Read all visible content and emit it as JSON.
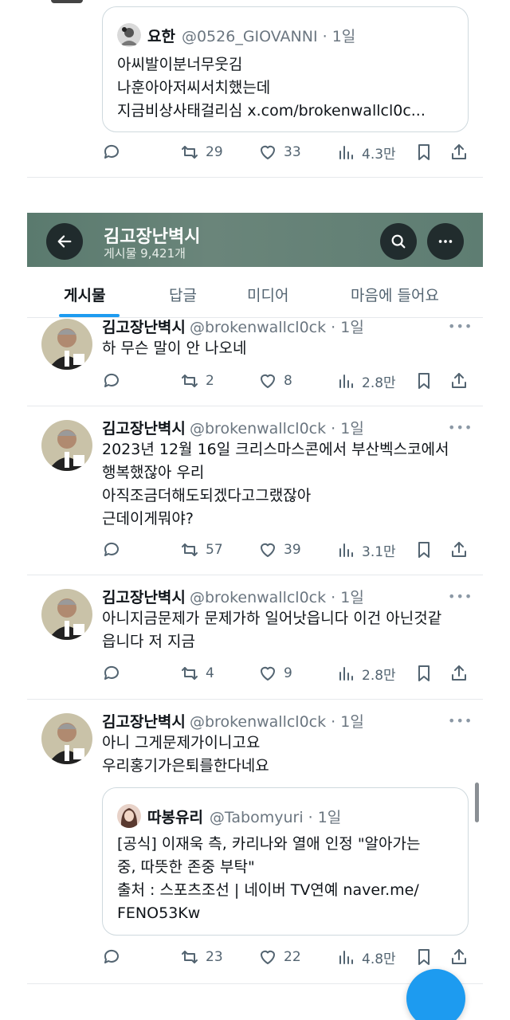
{
  "top_quote": {
    "author": "요한",
    "handle": "@0526_GIOVANNI · 1일",
    "lines": [
      "아씨발이분너무웃김",
      "나훈아아저씨서치했는데",
      "지금비상사태걸리심 x.com/brokenwallcl0c..."
    ]
  },
  "top_actions": {
    "retweets": "29",
    "likes": "33",
    "views": "4.3만"
  },
  "profile_header": {
    "name": "김고장난벽시",
    "post_count": "게시물 9,421개"
  },
  "tabs": [
    "게시물",
    "답글",
    "미디어",
    "마음에 들어요"
  ],
  "tweets": [
    {
      "name": "김고장난벽시",
      "handle": "@brokenwallcl0ck · 1일",
      "lines": [
        "하 무슨 말이 안 나오네"
      ],
      "retweets": "2",
      "likes": "8",
      "views": "2.8만"
    },
    {
      "name": "김고장난벽시",
      "handle": "@brokenwallcl0ck · 1일",
      "lines": [
        "2023년 12월 16일 크리스마스콘에서 부산벡스코에서",
        "행복했잖아 우리",
        "아직조금더해도되겠다고그랬잖아",
        "근데이게뭐야?"
      ],
      "retweets": "57",
      "likes": "39",
      "views": "3.1만"
    },
    {
      "name": "김고장난벽시",
      "handle": "@brokenwallcl0ck · 1일",
      "lines": [
        "아니지금문제가 문제가하 일어낫읍니다 이건 아닌것같",
        "읍니다 저 지금"
      ],
      "retweets": "4",
      "likes": "9",
      "views": "2.8만"
    },
    {
      "name": "김고장난벽시",
      "handle": "@brokenwallcl0ck · 1일",
      "lines": [
        "아니 그게문제가이니고요",
        "우리홍기가은퇴를한다네요"
      ],
      "retweets": "23",
      "likes": "22",
      "views": "4.8만",
      "quote": {
        "author": "따봉유리",
        "handle": "@Tabomyuri · 1일",
        "lines": [
          "[공식] 이재욱 측, 카리나와 열애 인정 \"알아가는",
          "중, 따뜻한 존중 부탁\"",
          "출처 : 스포츠조선 | 네이버 TV연예 naver.me/",
          "FENO53Kw"
        ]
      }
    }
  ],
  "colors": {
    "header_bg": "#5e7d72",
    "accent": "#1d9bf0",
    "icon": "#536471",
    "handle": "#6b7680"
  }
}
